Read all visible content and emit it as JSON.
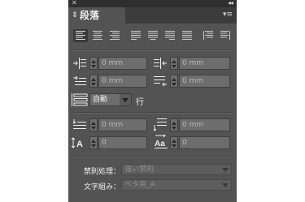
{
  "panel": {
    "close_label": "✕",
    "collapse_label": "◂◂",
    "tab_title": "段落",
    "tab_arrows": "⇕",
    "menu_label": "▾≡"
  },
  "indent": {
    "left": {
      "value": "",
      "placeholder": "0 mm"
    },
    "right": {
      "value": "",
      "placeholder": "0 mm"
    },
    "first_line": {
      "value": "",
      "placeholder": "0 mm"
    },
    "last_line": {
      "value": "",
      "placeholder": "0 mm"
    }
  },
  "grid_lines": {
    "value": "自動",
    "unit": "行"
  },
  "spacing": {
    "before": {
      "value": "",
      "placeholder": "0 mm"
    },
    "after": {
      "value": "",
      "placeholder": "0 mm"
    },
    "drop_cap_lines": {
      "value": "",
      "placeholder": "0"
    },
    "drop_cap_chars": {
      "value": "",
      "placeholder": "0"
    }
  },
  "kinsoku": {
    "label": "禁則処理：",
    "value": "強い禁則"
  },
  "mojikumi": {
    "label": "文字組み：",
    "value": "ベタ用_A"
  }
}
